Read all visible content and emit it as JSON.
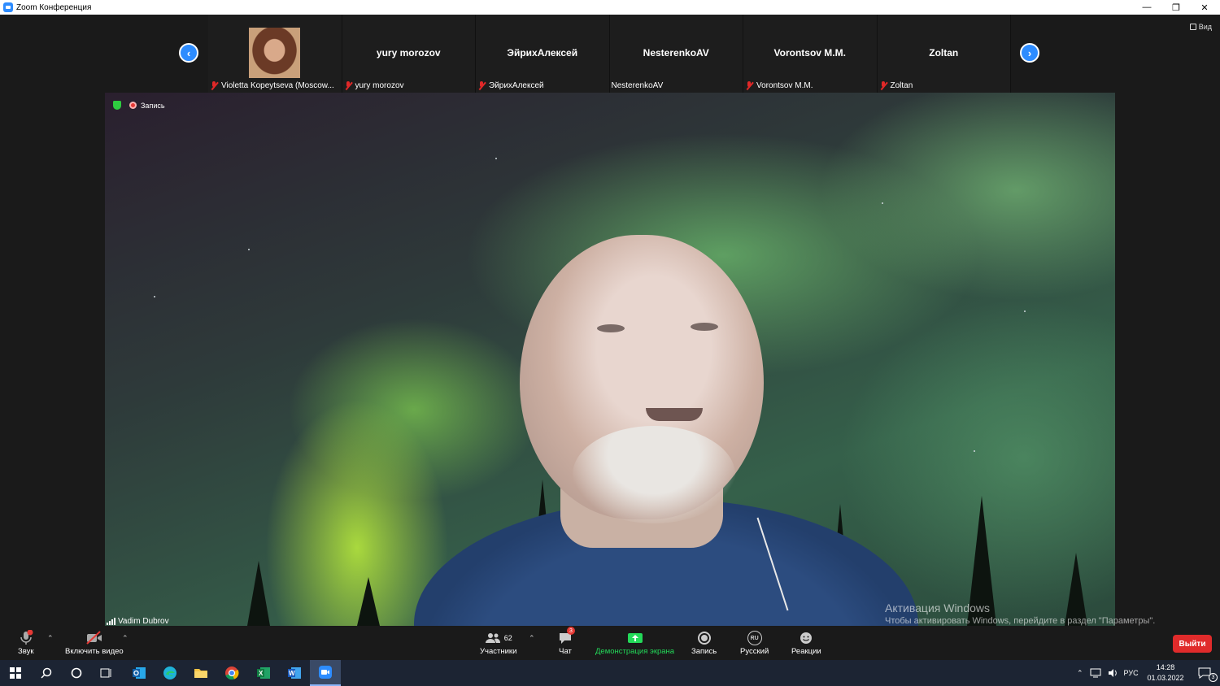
{
  "window": {
    "title": "Zoom Конференция"
  },
  "thumbnails": [
    {
      "name": "",
      "label": "Violetta Kopeytseva (Moscow...",
      "muted": true,
      "has_photo": true
    },
    {
      "name": "yury morozov",
      "label": "yury morozov",
      "muted": true
    },
    {
      "name": "ЭйрихАлексей",
      "label": "ЭйрихАлексей",
      "muted": true
    },
    {
      "name": "NesterenkoAV",
      "label": "NesterenkoAV",
      "muted": false
    },
    {
      "name": "Vorontsov M.M.",
      "label": "Vorontsov M.M.",
      "muted": true
    },
    {
      "name": "Zoltan",
      "label": "Zoltan",
      "muted": true
    }
  ],
  "view_button": {
    "label": "Вид"
  },
  "video": {
    "recording_label": "Запись",
    "speaker_name": "Vadim Dubrov"
  },
  "activation": {
    "title": "Активация Windows",
    "subtitle": "Чтобы активировать Windows, перейдите в раздел \"Параметры\"."
  },
  "toolbar": {
    "audio_label": "Звук",
    "video_label": "Включить видео",
    "participants_label": "Участники",
    "participants_count": "62",
    "chat_label": "Чат",
    "chat_badge": "3",
    "share_label": "Демонстрация экрана",
    "record_label": "Запись",
    "language_label": "Русский",
    "language_code": "RU",
    "reactions_label": "Реакции",
    "leave_label": "Выйти"
  },
  "colors": {
    "accent": "#2d8cff",
    "danger": "#e02b2b",
    "share": "#23d959"
  },
  "taskbar": {
    "lang": "РУС",
    "time": "14:28",
    "date": "01.03.2022",
    "notif_count": "3"
  }
}
